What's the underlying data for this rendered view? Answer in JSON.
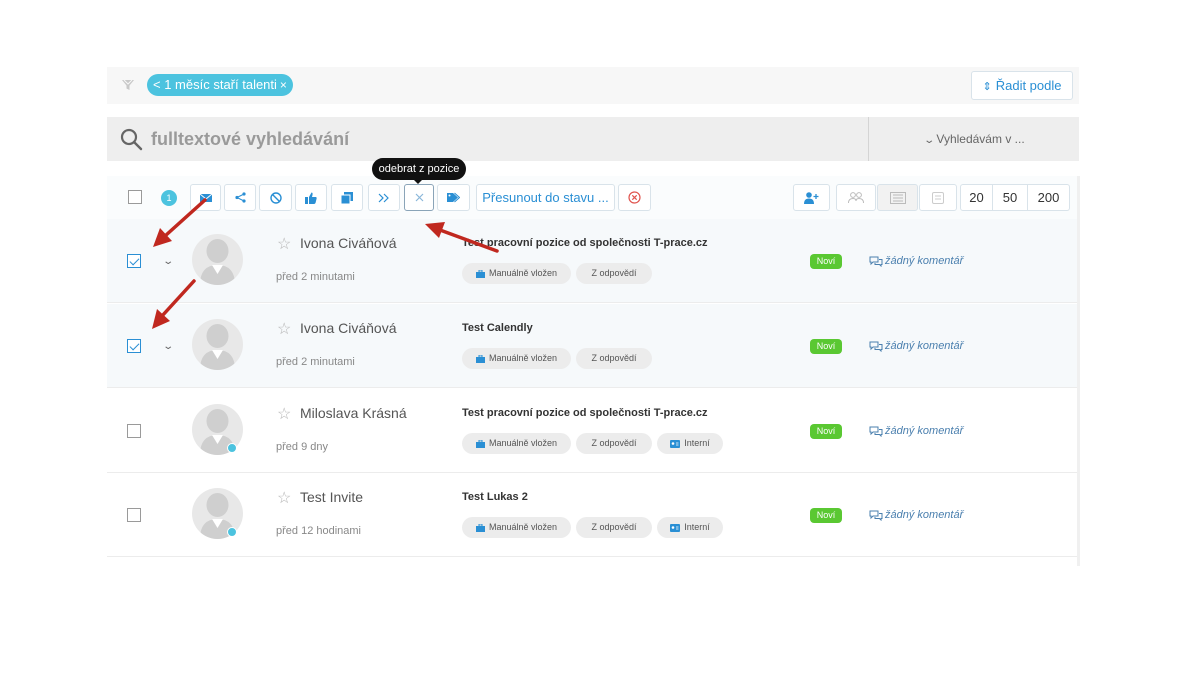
{
  "filter": {
    "icon": "filter-icon",
    "chip_label": "< 1 měsíc staří talenti",
    "chip_remove": "×",
    "sort_label": "Řadit podle",
    "sort_icon": "sort-icon"
  },
  "search": {
    "placeholder": "fulltextové vyhledávání",
    "scope_label": "Vyhledávám v ..."
  },
  "toolbar": {
    "selected_count": "1",
    "move_label": "Přesunout do stavu ...",
    "tooltip": "odebrat z pozice",
    "page_sizes": [
      "20",
      "50",
      "200"
    ]
  },
  "candidates": [
    {
      "name": "Ivona Civáňová",
      "time": "před 2 minutami",
      "position": "Test pracovní pozice od společnosti T-prace.cz",
      "tags": [
        "Manuálně vložen",
        "Z odpovědí"
      ],
      "status": "Noví",
      "comment": "žádný komentář",
      "checked": true
    },
    {
      "name": "Ivona Civáňová",
      "time": "před 2 minutami",
      "position": "Test Calendly",
      "tags": [
        "Manuálně vložen",
        "Z odpovědí"
      ],
      "status": "Noví",
      "comment": "žádný komentář",
      "checked": true
    },
    {
      "name": "Miloslava Krásná",
      "time": "před 9 dny",
      "position": "Test pracovní pozice od společnosti T-prace.cz",
      "tags": [
        "Manuálně vložen",
        "Z odpovědí",
        "Interní"
      ],
      "status": "Noví",
      "comment": "žádný komentář",
      "checked": false
    },
    {
      "name": "Test Invite",
      "time": "před 12 hodinami",
      "position": "Test Lukas 2",
      "tags": [
        "Manuálně vložen",
        "Z odpovědí",
        "Interní"
      ],
      "status": "Noví",
      "comment": "žádný komentář",
      "checked": false
    }
  ],
  "colors": {
    "accent": "#2a8fd4",
    "chip": "#4cc3df",
    "status_new": "#5ac832",
    "annotation_arrow": "#c0281f"
  }
}
